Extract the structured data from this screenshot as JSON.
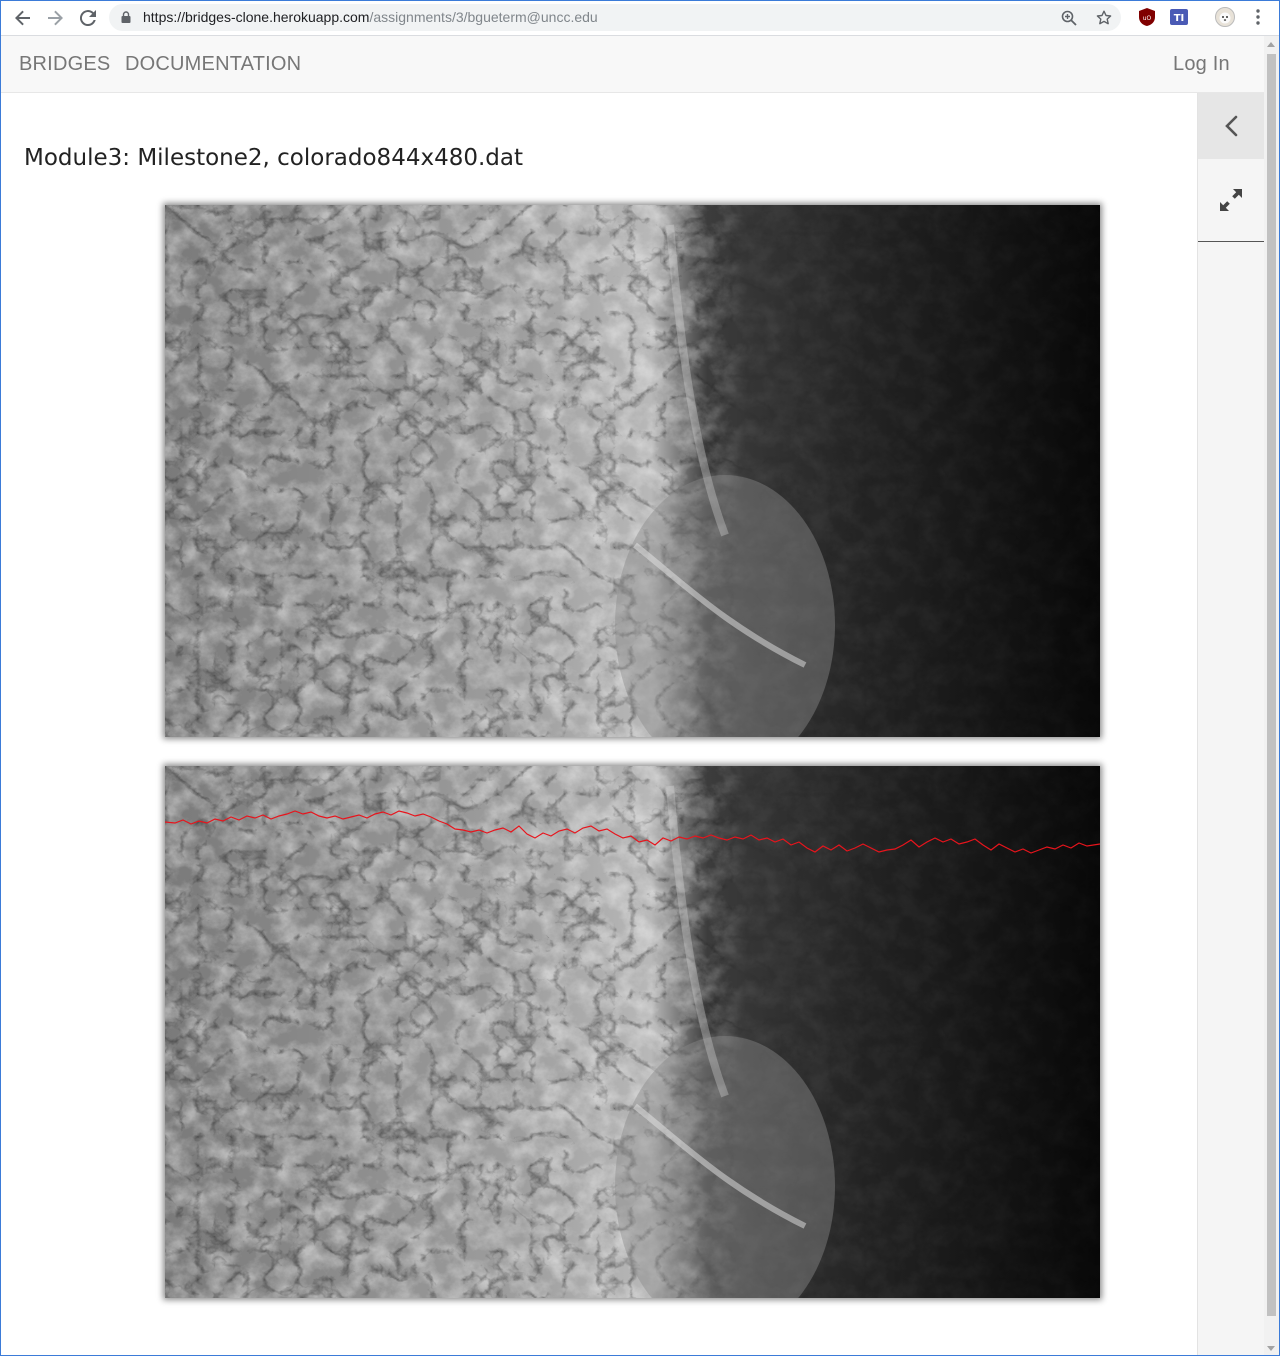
{
  "browser": {
    "url_host": "https://bridges-clone.herokuapp.com",
    "url_path": "/assignments/3/bgueterm@uncc.edu"
  },
  "navbar": {
    "brand": "BRIDGES",
    "documentation": "DOCUMENTATION",
    "login": "Log In"
  },
  "page": {
    "title": "Module3: Milestone2, colorado844x480.dat"
  },
  "visualizations": [
    {
      "kind": "elevation-grayscale",
      "path_overlay": false
    },
    {
      "kind": "elevation-grayscale",
      "path_overlay": true,
      "path_color": "#e8141c"
    }
  ],
  "colors": {
    "nav_text": "#777777",
    "path": "#e8141c",
    "side_panel": "#f5f5f5"
  }
}
